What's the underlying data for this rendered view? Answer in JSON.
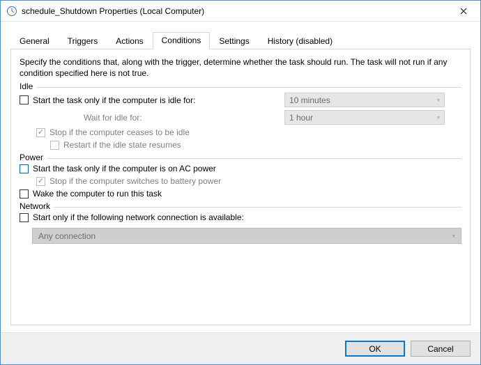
{
  "window": {
    "title": "schedule_Shutdown Properties (Local Computer)"
  },
  "tabs": {
    "general": "General",
    "triggers": "Triggers",
    "actions": "Actions",
    "conditions": "Conditions",
    "settings": "Settings",
    "history": "History (disabled)",
    "active": "conditions"
  },
  "intro": "Specify the conditions that, along with the trigger, determine whether the task should run.  The task will not run  if any condition specified here is not true.",
  "groups": {
    "idle": {
      "title": "Idle",
      "start_only_idle": {
        "label": "Start the task only if the computer is idle for:",
        "checked": false
      },
      "idle_for_value": "10 minutes",
      "wait_label": "Wait for idle for:",
      "wait_value": "1 hour",
      "stop_if_cease": {
        "label": "Stop if the computer ceases to be idle",
        "checked": true,
        "disabled": true
      },
      "restart_if_resumes": {
        "label": "Restart if the idle state resumes",
        "checked": false,
        "disabled": true
      }
    },
    "power": {
      "title": "Power",
      "start_on_ac": {
        "label": "Start the task only if the computer is on AC power",
        "checked": false
      },
      "stop_on_battery": {
        "label": "Stop if the computer switches to battery power",
        "checked": true,
        "disabled": true
      },
      "wake": {
        "label": "Wake the computer to run this task",
        "checked": false
      }
    },
    "network": {
      "title": "Network",
      "start_if_network": {
        "label": "Start only if the following network connection is available:",
        "checked": false
      },
      "connection_value": "Any connection"
    }
  },
  "buttons": {
    "ok": "OK",
    "cancel": "Cancel"
  }
}
